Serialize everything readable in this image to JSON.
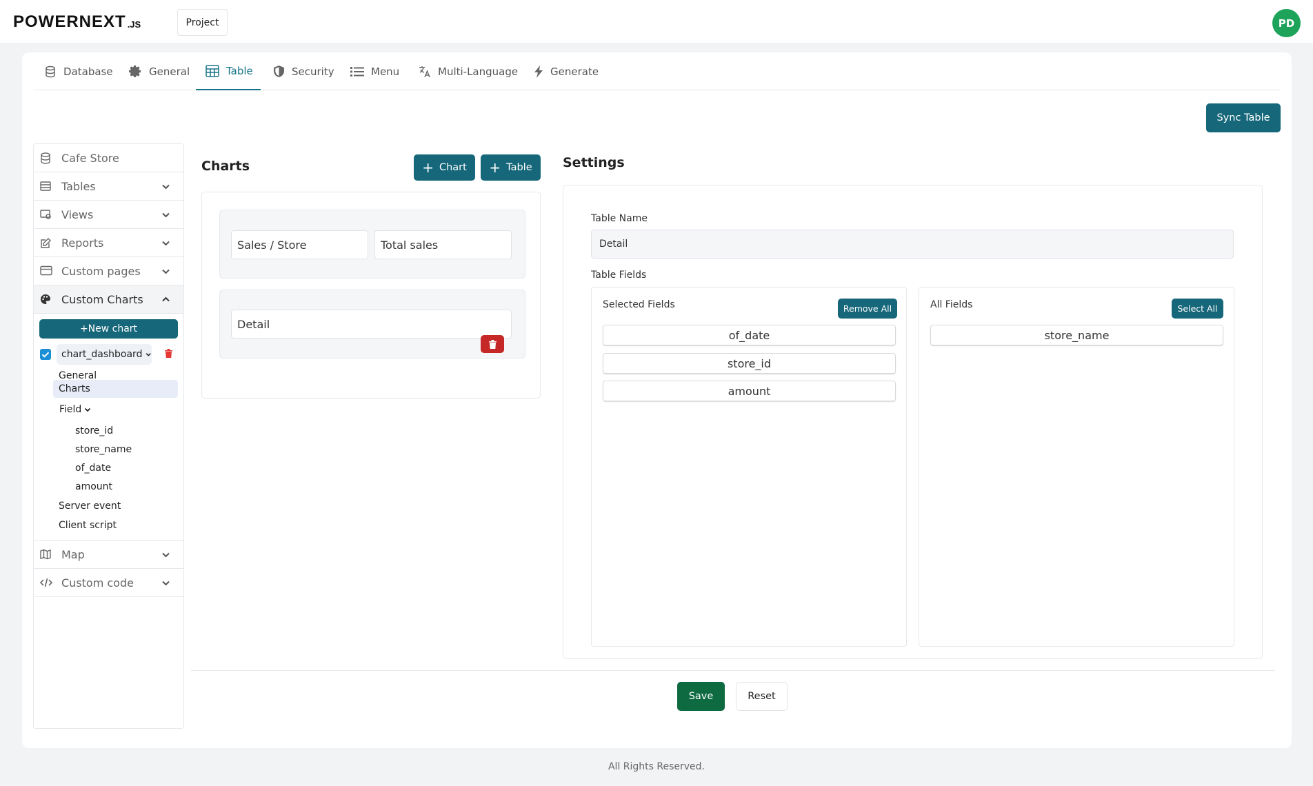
{
  "app": {
    "logo_text": "POWERNEXT",
    "logo_suffix": ".JS",
    "project_label": "Project",
    "avatar_initials": "PD"
  },
  "tabs": [
    {
      "label": "Database",
      "icon": "database-icon",
      "active": false
    },
    {
      "label": "General",
      "icon": "gear-icon",
      "active": false
    },
    {
      "label": "Table",
      "icon": "table-icon",
      "active": true
    },
    {
      "label": "Security",
      "icon": "shield-icon",
      "active": false
    },
    {
      "label": "Menu",
      "icon": "list-icon",
      "active": false
    },
    {
      "label": "Multi-Language",
      "icon": "translate-icon",
      "active": false
    },
    {
      "label": "Generate",
      "icon": "bolt-icon",
      "active": false
    }
  ],
  "toolbar": {
    "sync_label": "Sync Table"
  },
  "sidebar": {
    "items": [
      {
        "label": "Cafe Store",
        "icon": "database-icon"
      },
      {
        "label": "Tables",
        "icon": "table-icon"
      },
      {
        "label": "Views",
        "icon": "view-icon"
      },
      {
        "label": "Reports",
        "icon": "edit-icon"
      },
      {
        "label": "Custom pages",
        "icon": "card-icon"
      },
      {
        "label": "Custom Charts",
        "icon": "palette-icon"
      },
      {
        "label": "Map",
        "icon": "map-icon"
      },
      {
        "label": "Custom code",
        "icon": "code-icon"
      }
    ],
    "new_chart_label": "+New chart",
    "dashboard": {
      "name": "chart_dashboard",
      "checked": true
    },
    "tree": {
      "general": "General",
      "charts": "Charts",
      "field": "Field",
      "fields": [
        "store_id",
        "store_name",
        "of_date",
        "amount"
      ],
      "server_event": "Server event",
      "client_script": "Client script"
    }
  },
  "charts": {
    "title": "Charts",
    "add_chart_label": "Chart",
    "add_table_label": "Table",
    "rows": [
      {
        "cells": [
          "Sales / Store",
          "Total sales"
        ]
      },
      {
        "cells": [
          "Detail"
        ]
      }
    ]
  },
  "settings": {
    "title": "Settings",
    "table_name_label": "Table Name",
    "table_name_value": "Detail",
    "table_fields_label": "Table Fields",
    "selected": {
      "title": "Selected Fields",
      "button": "Remove All",
      "fields": [
        "of_date",
        "store_id",
        "amount"
      ]
    },
    "all": {
      "title": "All Fields",
      "button": "Select All",
      "fields": [
        "store_name"
      ]
    }
  },
  "actions": {
    "save_label": "Save",
    "reset_label": "Reset"
  },
  "footer": {
    "text": "All Rights Reserved."
  },
  "colors": {
    "primary": "#16677a",
    "active_tab": "#17748b",
    "save": "#0e6a40",
    "delete": "#c62828",
    "avatar": "#1ea35a"
  }
}
